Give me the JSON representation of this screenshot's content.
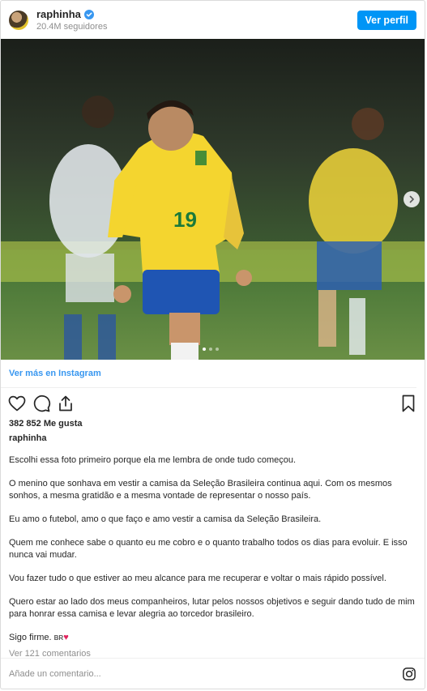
{
  "header": {
    "username": "raphinha",
    "followers": "20.4M seguidores",
    "follow_button": "Ver perfil"
  },
  "photo": {
    "alt": "Raphinha celebrating in Brazil jersey number 19",
    "player_number": "19",
    "carousel_dots": 3,
    "carousel_active": 1
  },
  "links": {
    "view_more": "Ver más en Instagram"
  },
  "stats": {
    "likes": "382 852 Me gusta"
  },
  "caption": {
    "username": "raphinha",
    "paragraphs": [
      "Escolhi essa foto primeiro porque ela me lembra de onde tudo começou.",
      "O menino que sonhava em vestir a camisa da Seleção Brasileira continua aqui. Com os mesmos sonhos, a mesma gratidão e a mesma vontade de representar o nosso país.",
      "Eu amo o futebol, amo o que faço e amo vestir a camisa da Seleção Brasileira.",
      "Quem me conhece sabe o quanto eu me cobro e o quanto trabalho todos os dias para evoluir. E isso nunca vai mudar.",
      "Vou fazer tudo o que estiver ao meu alcance para me recuperar e voltar o mais rápido possível.",
      "Quero estar ao lado dos meus companheiros, lutar pelos nossos objetivos e seguir dando tudo de mim para honrar essa camisa e levar alegria ao torcedor brasileiro.",
      "Sigo firme."
    ],
    "last_flag": "BR"
  },
  "comments": {
    "view_all": "Ver 121 comentarios",
    "placeholder": "Añade un comentario..."
  },
  "colors": {
    "accent": "#0095f6",
    "link": "#3897f0",
    "muted": "#8e8e8e",
    "heart": "#e0245e"
  }
}
